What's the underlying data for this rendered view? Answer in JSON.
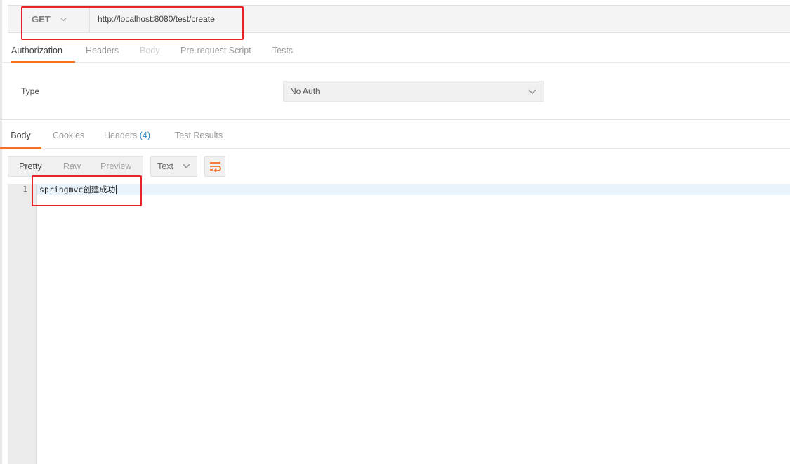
{
  "request": {
    "method": "GET",
    "url": "http://localhost:8080/test/create"
  },
  "request_tabs": [
    {
      "label": "Authorization",
      "state": "active"
    },
    {
      "label": "Headers",
      "state": "normal"
    },
    {
      "label": "Body",
      "state": "disabled"
    },
    {
      "label": "Pre-request Script",
      "state": "normal"
    },
    {
      "label": "Tests",
      "state": "normal"
    }
  ],
  "auth": {
    "type_label": "Type",
    "type_value": "No Auth"
  },
  "response_tabs": {
    "body": "Body",
    "cookies": "Cookies",
    "headers": "Headers",
    "headers_count": "(4)",
    "test_results": "Test Results"
  },
  "view_modes": [
    {
      "label": "Pretty",
      "state": "active"
    },
    {
      "label": "Raw",
      "state": "normal"
    },
    {
      "label": "Preview",
      "state": "normal"
    }
  ],
  "format": "Text",
  "editor": {
    "line_number": "1",
    "content": "springmvc创建成功"
  },
  "colors": {
    "accent": "#f47023",
    "annotation": "#e8232a",
    "count": "#2a8ac7"
  }
}
